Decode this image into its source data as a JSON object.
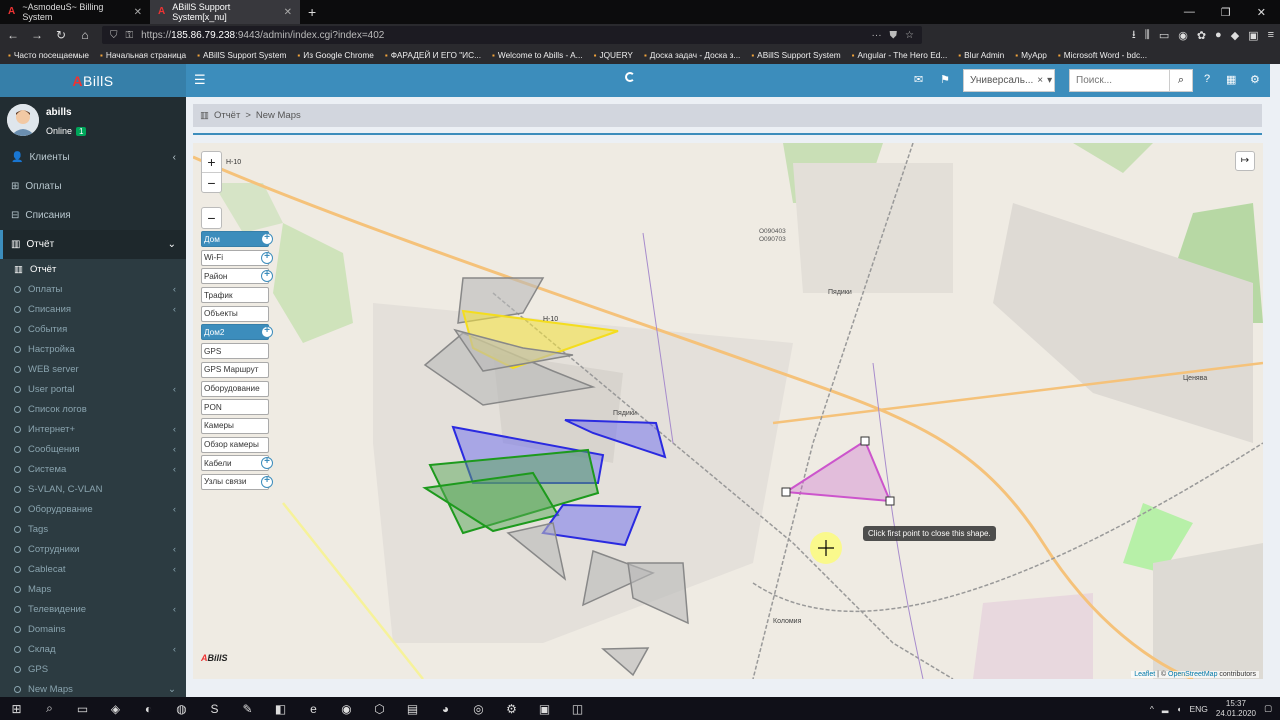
{
  "browser": {
    "tabs": [
      {
        "label": "~AsmodeuS~ Billing System"
      },
      {
        "label": "ABillS Support System[x_nu]"
      }
    ],
    "url_prefix": "https://",
    "url_host": "185.86.79.238",
    "url_rest": ":9443/admin/index.cgi?index=402",
    "bookmarks": [
      "Часто посещаемые",
      "Начальная страница",
      "ABillS Support System",
      "Из Google Chrome",
      "ФАРАДЕЙ И ЕГО \"ИС...",
      "Welcome to Abills - A...",
      "JQUERY",
      "Доска задач - Доска з...",
      "ABillS Support System",
      "Angular - The Hero Ed...",
      "Blur Admin",
      "MyApp",
      "Microsoft Word - bdc..."
    ]
  },
  "app": {
    "logo_a": "A",
    "logo_rest": "BillS",
    "select_value": "Универсаль...",
    "search_placeholder": "Поиск..."
  },
  "user": {
    "name": "abills",
    "status": "Online",
    "badge": "1"
  },
  "sidebar": {
    "top": [
      {
        "label": "Клиенты",
        "icon": "user-icon",
        "chev": "‹"
      },
      {
        "label": "Оплаты",
        "icon": "plus-square-icon"
      },
      {
        "label": "Списания",
        "icon": "minus-square-icon"
      }
    ],
    "open": {
      "label": "Отчёт",
      "icon": "bar-chart-icon",
      "chev": "⌄"
    },
    "sub": [
      {
        "label": "Отчёт",
        "cur": true
      },
      {
        "label": "Оплаты",
        "chev": "‹"
      },
      {
        "label": "Списания",
        "chev": "‹"
      },
      {
        "label": "События"
      },
      {
        "label": "Настройка"
      },
      {
        "label": "WEB server"
      },
      {
        "label": "User portal",
        "chev": "‹"
      },
      {
        "label": "Список логов"
      },
      {
        "label": "Интернет+",
        "chev": "‹"
      },
      {
        "label": "Сообщения",
        "chev": "‹"
      },
      {
        "label": "Система",
        "chev": "‹"
      },
      {
        "label": "S-VLAN, C-VLAN"
      },
      {
        "label": "Оборудование",
        "chev": "‹"
      },
      {
        "label": "Tags"
      },
      {
        "label": "Сотрудники",
        "chev": "‹"
      },
      {
        "label": "Cablecat",
        "chev": "‹"
      },
      {
        "label": "Maps"
      },
      {
        "label": "Телевидение",
        "chev": "‹"
      },
      {
        "label": "Domains"
      },
      {
        "label": "Склад",
        "chev": "‹"
      },
      {
        "label": "GPS"
      },
      {
        "label": "New Maps",
        "chev": "⌄"
      }
    ]
  },
  "breadcrumb": {
    "root": "Отчёт",
    "sep": ">",
    "current": "New Maps"
  },
  "map": {
    "layers": [
      {
        "label": "Дом",
        "active": true,
        "plus": true
      },
      {
        "label": "Wi-Fi",
        "plus": true
      },
      {
        "label": "Район",
        "plus": true
      },
      {
        "label": "Трафик"
      },
      {
        "label": "Объекты"
      },
      {
        "label": "Дом2",
        "active": true,
        "plus": true
      },
      {
        "label": "GPS"
      },
      {
        "label": "GPS Маршрут"
      },
      {
        "label": "Оборудование"
      },
      {
        "label": "PON"
      },
      {
        "label": "Камеры"
      },
      {
        "label": "Обзор камеры"
      },
      {
        "label": "Кабели",
        "plus": true
      },
      {
        "label": "Узлы связи",
        "plus": true
      }
    ],
    "tooltip": "Click first point to close this shape.",
    "place_labels": [
      "Н-10",
      "Н-10",
      "О090403",
      "О090703",
      "Пядики",
      "Ценява",
      "Коломия",
      "Пядики"
    ],
    "attr_leaflet": "Leaflet",
    "attr_sep": " | © ",
    "attr_osm": "OpenStreetMap",
    "attr_rest": " contributors",
    "logo_a": "A",
    "logo_rest": "BillS"
  },
  "taskbar": {
    "lang": "ENG",
    "time": "15:37",
    "date": "24.01.2020"
  }
}
